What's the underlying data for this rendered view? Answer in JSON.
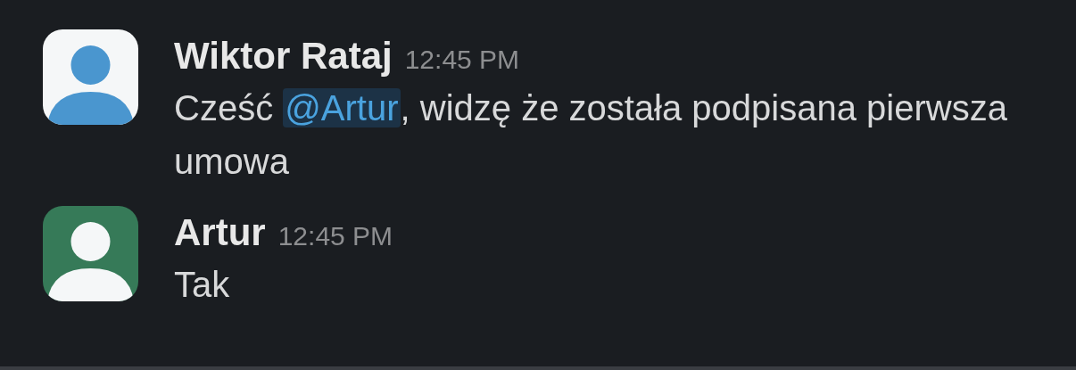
{
  "messages": [
    {
      "author": "Wiktor Rataj",
      "time": "12:45 PM",
      "color": "#4a96cf",
      "segments": [
        {
          "kind": "text",
          "text": "Cześć "
        },
        {
          "kind": "mention",
          "text": "@Artur"
        },
        {
          "kind": "text",
          "text": ", widzę że została podpisana pierwsza umowa"
        }
      ]
    },
    {
      "author": "Artur",
      "time": "12:45 PM",
      "color": "#367a58",
      "segments": [
        {
          "kind": "text",
          "text": "Tak"
        }
      ]
    }
  ]
}
